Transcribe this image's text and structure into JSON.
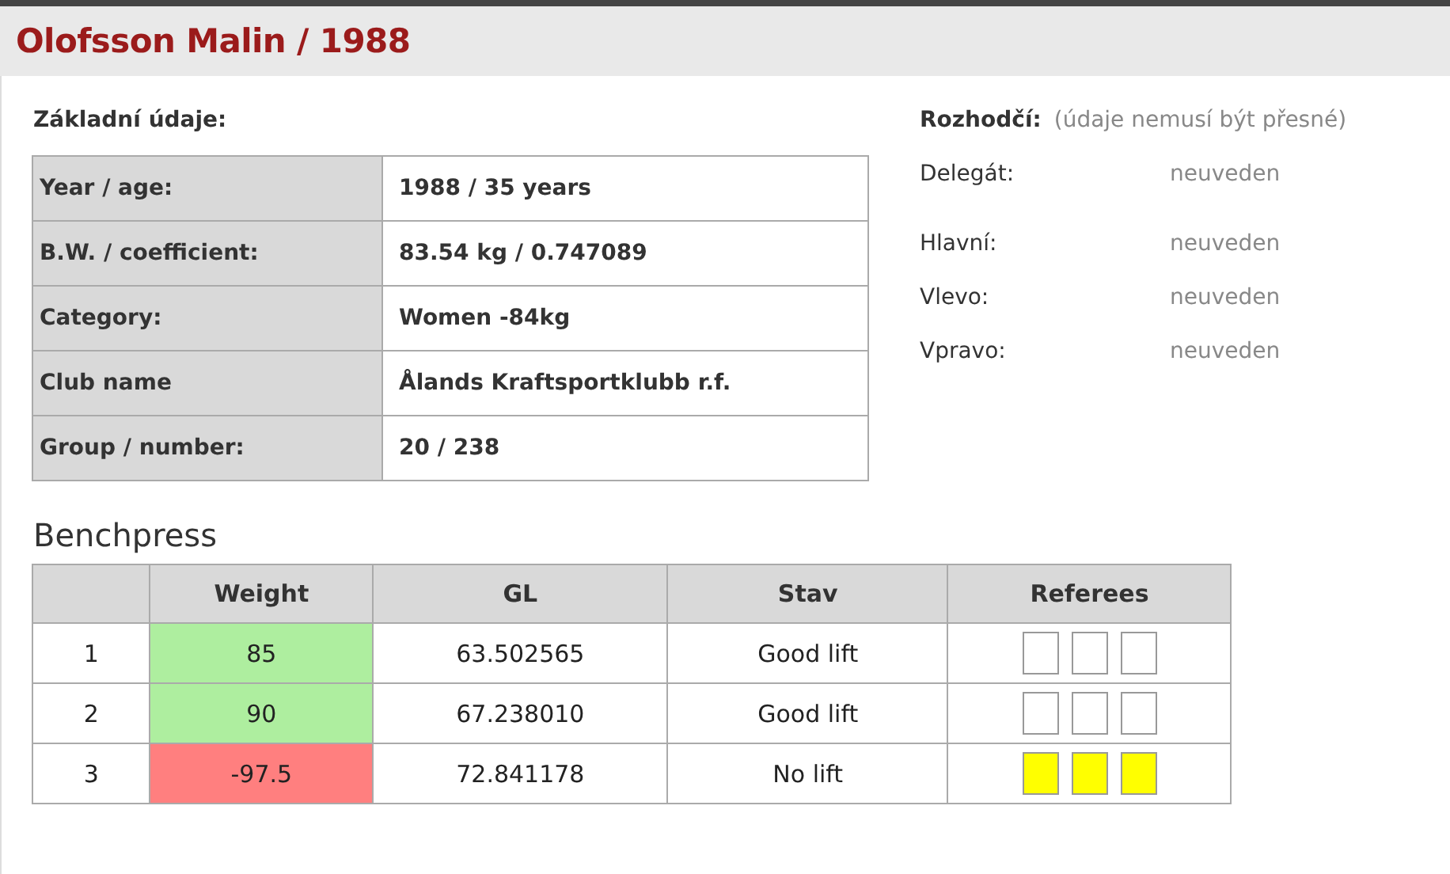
{
  "title": "Olofsson Malin / 1988",
  "basic": {
    "heading": "Základní údaje:",
    "rows": [
      {
        "label": "Year / age:",
        "value": "1988 / 35 years"
      },
      {
        "label": "B.W. / coefficient:",
        "value": "83.54 kg / 0.747089"
      },
      {
        "label": "Category:",
        "value": "Women -84kg"
      },
      {
        "label": "Club name",
        "value": "Ålands Kraftsportklubb r.f."
      },
      {
        "label": "Group / number:",
        "value": "20 / 238"
      }
    ]
  },
  "referees": {
    "heading": "Rozhodčí:",
    "note": "(údaje nemusí být přesné)",
    "rows": [
      {
        "label": "Delegát:",
        "value": "neuveden"
      },
      {
        "label": "Hlavní:",
        "value": "neuveden"
      },
      {
        "label": "Vlevo:",
        "value": "neuveden"
      },
      {
        "label": "Vpravo:",
        "value": "neuveden"
      }
    ]
  },
  "lift": {
    "heading": "Benchpress",
    "columns": [
      "Weight",
      "GL",
      "Stav",
      "Referees"
    ],
    "attempts": [
      {
        "number": "1",
        "weight": "85",
        "kind": "good",
        "gl": "63.502565",
        "status": "Good lift",
        "lights": [
          {
            "color": "#ffffff"
          },
          {
            "color": "#ffffff"
          },
          {
            "color": "#ffffff"
          }
        ]
      },
      {
        "number": "2",
        "weight": "90",
        "kind": "good",
        "gl": "67.238010",
        "status": "Good lift",
        "lights": [
          {
            "color": "#ffffff"
          },
          {
            "color": "#ffffff"
          },
          {
            "color": "#ffffff"
          }
        ]
      },
      {
        "number": "3",
        "weight": "-97.5",
        "kind": "bad",
        "gl": "72.841178",
        "status": "No lift",
        "lights": [
          {
            "color": "#ffff00"
          },
          {
            "color": "#ffff00"
          },
          {
            "color": "#ffff00"
          }
        ]
      }
    ]
  }
}
